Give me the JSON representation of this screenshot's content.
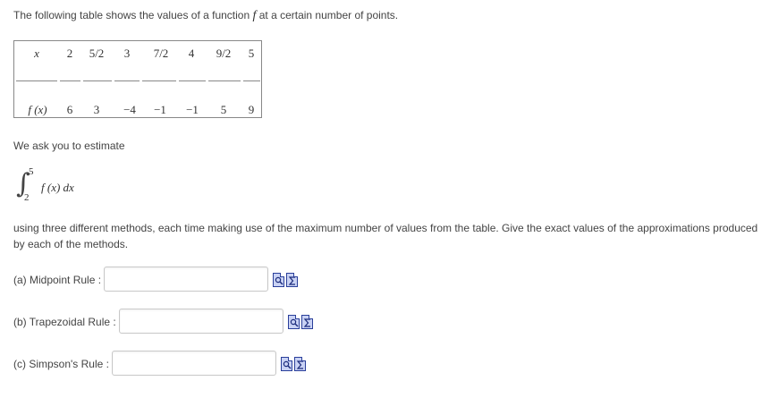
{
  "intro": {
    "before": "The following table shows the values of a function ",
    "symbol": "f",
    "after": " at a certain number of points."
  },
  "table": {
    "row_x_label": "x",
    "row_fx_label": "f (x)",
    "x_values": [
      "2",
      "5/2",
      "3",
      "7/2",
      "4",
      "9/2",
      "5"
    ],
    "fx_values": [
      "6",
      "3",
      "−4",
      "−1",
      "−1",
      "5",
      "9"
    ]
  },
  "ask": "We ask you to estimate",
  "integral": {
    "upper": "5",
    "lower": "2",
    "integrand": "f (x) dx"
  },
  "methods_text": "using three different methods, each time making use of the maximum number of values from the table. Give the exact values of the approximations produced by each of the methods.",
  "questions": [
    {
      "label": "(a) Midpoint Rule :",
      "value": ""
    },
    {
      "label": "(b) Trapezoidal Rule :",
      "value": ""
    },
    {
      "label": "(c) Simpson's Rule :",
      "value": ""
    }
  ],
  "tool_icons": [
    "preview-icon",
    "sigma-editor-icon"
  ]
}
